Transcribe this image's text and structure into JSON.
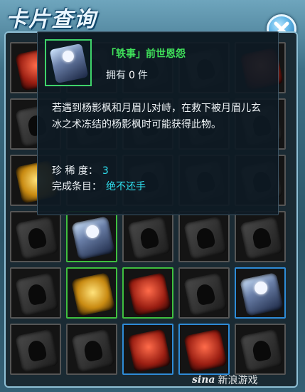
{
  "header": {
    "title": "卡片查询"
  },
  "tooltip": {
    "card_name": "「轶事」前世恩怨",
    "owned_label": "拥有",
    "owned_count": "0",
    "owned_unit": "件",
    "description": "若遇到杨影枫和月眉儿对峙，在救下被月眉儿玄冰之术冻结的杨影枫时可能获得此物。",
    "rarity_label": "珍 稀 度：",
    "rarity_value": "3",
    "condition_label": "完成条目：",
    "condition_value": "绝不还手"
  },
  "grid": {
    "cards": [
      {
        "style": "red",
        "border": "gray"
      },
      {
        "style": "dark",
        "border": "gray"
      },
      {
        "style": "dark",
        "border": "gray"
      },
      {
        "style": "dark",
        "border": "gray"
      },
      {
        "style": "red",
        "border": "gray"
      },
      {
        "style": "dark",
        "border": "gray"
      },
      {
        "style": "dark",
        "border": "gray"
      },
      {
        "style": "dark",
        "border": "gray"
      },
      {
        "style": "dark",
        "border": "gray"
      },
      {
        "style": "dark",
        "border": "gray"
      },
      {
        "style": "gold",
        "border": "gray"
      },
      {
        "style": "dark",
        "border": "gray"
      },
      {
        "style": "dark",
        "border": "gray"
      },
      {
        "style": "dark",
        "border": "gray"
      },
      {
        "style": "dark",
        "border": "gray"
      },
      {
        "style": "dark",
        "border": "gray"
      },
      {
        "style": "icy",
        "border": "green"
      },
      {
        "style": "dark",
        "border": "gray"
      },
      {
        "style": "dark",
        "border": "gray"
      },
      {
        "style": "dark",
        "border": "gray"
      },
      {
        "style": "dark",
        "border": "gray"
      },
      {
        "style": "gold",
        "border": "green"
      },
      {
        "style": "red",
        "border": "green"
      },
      {
        "style": "dark",
        "border": "gray"
      },
      {
        "style": "icy",
        "border": "blue"
      },
      {
        "style": "dark",
        "border": "gray"
      },
      {
        "style": "dark",
        "border": "gray"
      },
      {
        "style": "red",
        "border": "blue"
      },
      {
        "style": "red",
        "border": "blue"
      },
      {
        "style": "dark",
        "border": "gray"
      }
    ]
  },
  "watermark": {
    "logo": "sina",
    "text": "新浪游戏"
  }
}
